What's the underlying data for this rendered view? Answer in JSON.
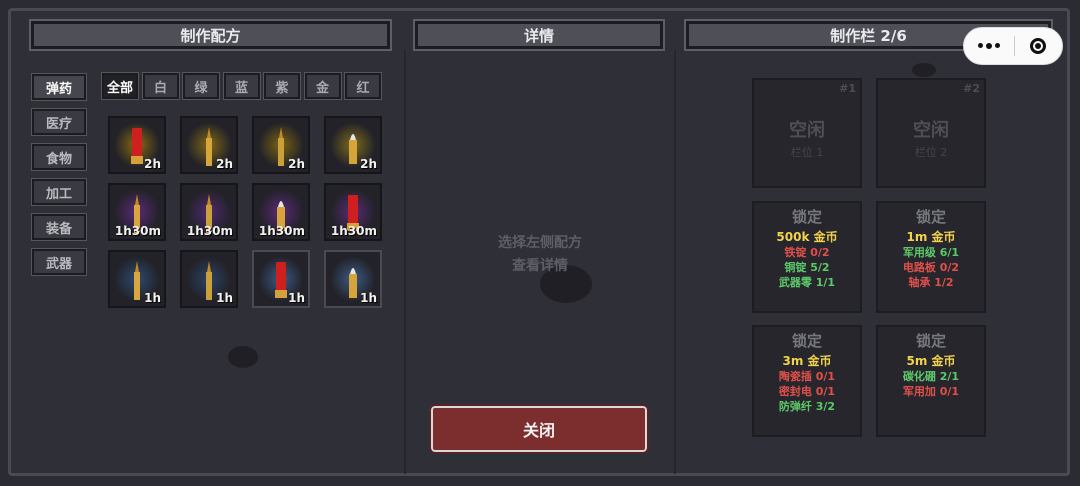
{
  "panels": {
    "recipes_title": "制作配方",
    "details_title": "详情",
    "queue_title": "制作栏 2/6"
  },
  "categories": [
    "弹药",
    "医疗",
    "食物",
    "加工",
    "装备",
    "武器"
  ],
  "filters": [
    "全部",
    "白",
    "绿",
    "蓝",
    "紫",
    "金",
    "红"
  ],
  "recipes": [
    {
      "time": "2h",
      "glow": "#8a6b12",
      "type": "shell",
      "color": "#d01f1f"
    },
    {
      "time": "2h",
      "glow": "#806717",
      "type": "rifle",
      "color": "#d8a63a"
    },
    {
      "time": "2h",
      "glow": "#7a6312",
      "type": "rifle",
      "color": "#c9a03a"
    },
    {
      "time": "2h",
      "glow": "#7d6a1d",
      "type": "pistol",
      "color": "#e6e6e6"
    },
    {
      "time": "1h30m",
      "glow": "#5a2a78",
      "type": "rifle",
      "color": "#d8a63a"
    },
    {
      "time": "1h30m",
      "glow": "#4f2a6d",
      "type": "rifle",
      "color": "#c9a03a"
    },
    {
      "time": "1h30m",
      "glow": "#5b2a7a",
      "type": "pistol",
      "color": "#e6e6e6"
    },
    {
      "time": "1h30m",
      "glow": "#5a2a78",
      "type": "shell",
      "color": "#d01f1f"
    },
    {
      "time": "1h",
      "glow": "#2d4a70",
      "type": "rifle",
      "color": "#d8a63a"
    },
    {
      "time": "1h",
      "glow": "#2b4264",
      "type": "rifle",
      "color": "#c9a03a"
    },
    {
      "time": "1h",
      "glow": "#3c5a86",
      "type": "shell",
      "color": "#d01f1f"
    },
    {
      "time": "1h",
      "glow": "#3c5a86",
      "type": "pistol",
      "color": "#e6e6e6"
    }
  ],
  "details_hint": [
    "选择左侧配方",
    "查看详情"
  ],
  "close_label": "关闭",
  "slots": [
    {
      "num": "#1",
      "state": "空闲",
      "label": "栏位 1"
    },
    {
      "num": "#2",
      "state": "空闲",
      "label": "栏位 2"
    }
  ],
  "locked": [
    {
      "title": "锁定",
      "cost": "500k 金币",
      "reqs": [
        {
          "text": "铁锭 0/2",
          "ok": false
        },
        {
          "text": "铜锭 5/2",
          "ok": true
        },
        {
          "text": "武器零 1/1",
          "ok": true
        }
      ]
    },
    {
      "title": "锁定",
      "cost": "1m 金币",
      "reqs": [
        {
          "text": "军用级 6/1",
          "ok": true
        },
        {
          "text": "电路板 0/2",
          "ok": false
        },
        {
          "text": "轴承 1/2",
          "ok": false
        }
      ]
    },
    {
      "title": "锁定",
      "cost": "3m 金币",
      "reqs": [
        {
          "text": "陶瓷插 0/1",
          "ok": false
        },
        {
          "text": "密封电 0/1",
          "ok": false
        },
        {
          "text": "防弹纤 3/2",
          "ok": true
        }
      ]
    },
    {
      "title": "锁定",
      "cost": "5m 金币",
      "reqs": [
        {
          "text": "碳化硼 2/1",
          "ok": true
        },
        {
          "text": "军用加 0/1",
          "ok": false
        }
      ]
    }
  ]
}
